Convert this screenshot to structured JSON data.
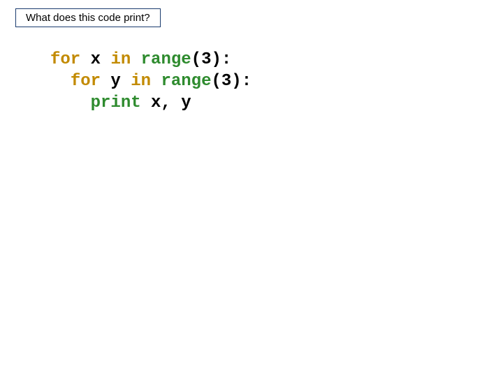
{
  "title": "What does this code print?",
  "code": {
    "l1": {
      "kw1": "for",
      "mid": " x ",
      "kw2": "in",
      "sp": " ",
      "fn": "range",
      "rest": "(3):"
    },
    "l2": {
      "indent": "  ",
      "kw1": "for",
      "mid": " y ",
      "kw2": "in",
      "sp": " ",
      "fn": "range",
      "rest": "(3):"
    },
    "l3": {
      "indent": "    ",
      "fn": "print",
      "rest": " x, y"
    }
  }
}
